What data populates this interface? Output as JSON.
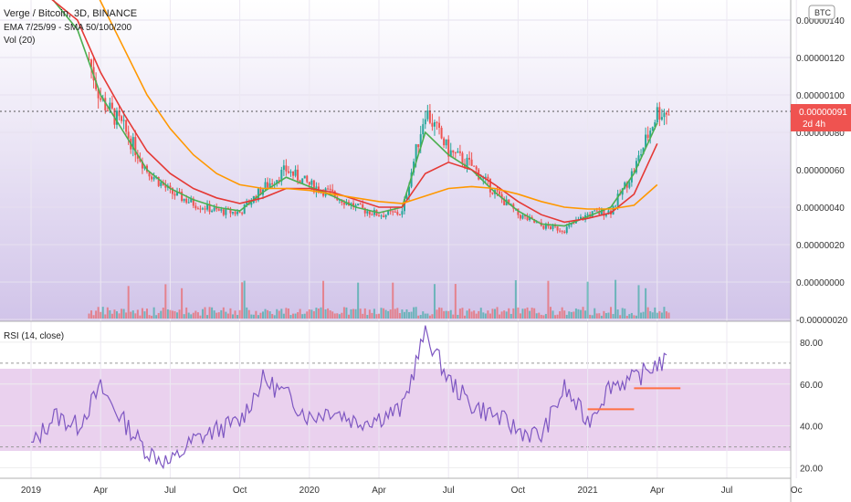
{
  "header": {
    "symbol_line": "Verge / Bitcoin, 3D, BINANCE",
    "ema_line": "EMA 7/25/99 - SMA 50/100/200",
    "vol_line": "Vol (20)",
    "currency_badge": "BTC"
  },
  "rsi_panel": {
    "title": "RSI (14, close)"
  },
  "last_price": {
    "value": "0.00000091",
    "countdown": "2d 4h"
  },
  "colors": {
    "up": "#26a69a",
    "down": "#ef5350",
    "ema7": "#4caf50",
    "ema25": "#e53935",
    "ema99": "#ff9800",
    "sma50": "#ff7043",
    "sma100": "#8e24aa",
    "sma200": "#5e35b1",
    "rsi_line": "#7e57c2",
    "rsi_band": "#e1bee7",
    "price_bg_top": "#ffffff",
    "price_bg_bottom": "#d1c4e9",
    "trend_line": "#ff7043"
  },
  "chart_data": [
    {
      "type": "line",
      "name": "price",
      "x_ticks": [
        "2019",
        "Apr",
        "Jul",
        "Oct",
        "2020",
        "Apr",
        "Jul",
        "Oct",
        "2021",
        "Apr",
        "Jul",
        "Oc"
      ],
      "y_ticks": [
        "0.00000140",
        "0.00000120",
        "0.00000100",
        "0.00000080",
        "0.00000060",
        "0.00000040",
        "0.00000020",
        "0.00000000",
        "-0.00000020"
      ],
      "ylim": [
        -2e-07,
        1.4e-06
      ],
      "x": [
        "2019-01",
        "2019-03",
        "2019-04",
        "2019-05",
        "2019-06",
        "2019-07",
        "2019-08",
        "2019-09",
        "2019-10",
        "2019-11",
        "2019-12",
        "2020-01",
        "2020-02",
        "2020-03",
        "2020-04",
        "2020-05",
        "2020-06",
        "2020-07",
        "2020-08",
        "2020-09",
        "2020-10",
        "2020-11",
        "2020-12",
        "2021-01",
        "2021-02",
        "2021-03",
        "2021-04"
      ],
      "close": [
        1.7e-06,
        1.4e-06,
        9.8e-07,
        8.2e-07,
        6e-07,
        4.8e-07,
        4.2e-07,
        3.8e-07,
        3.7e-07,
        5e-07,
        6e-07,
        5.2e-07,
        4.7e-07,
        4e-07,
        3.6e-07,
        3.7e-07,
        9.2e-07,
        7e-07,
        6.2e-07,
        4.8e-07,
        3.6e-07,
        3e-07,
        2.8e-07,
        3.6e-07,
        3.8e-07,
        6e-07,
        9.1e-07
      ],
      "series": [
        {
          "name": "EMA 7",
          "values": [
            1.65e-06,
            1.35e-06,
            1e-06,
            8e-07,
            6e-07,
            5e-07,
            4.4e-07,
            4e-07,
            3.8e-07,
            4.8e-07,
            5.6e-07,
            5.1e-07,
            4.6e-07,
            4e-07,
            3.7e-07,
            4e-07,
            8e-07,
            6.8e-07,
            6e-07,
            4.8e-07,
            3.8e-07,
            3.1e-07,
            3e-07,
            3.5e-07,
            4e-07,
            5.8e-07,
            8.5e-07
          ]
        },
        {
          "name": "EMA 25",
          "values": [
            1.6e-06,
            1.4e-06,
            1.12e-06,
            9e-07,
            7e-07,
            5.8e-07,
            5e-07,
            4.5e-07,
            4.2e-07,
            4.5e-07,
            5e-07,
            5e-07,
            4.8e-07,
            4.4e-07,
            4e-07,
            4e-07,
            5.8e-07,
            6.4e-07,
            6e-07,
            5.2e-07,
            4.3e-07,
            3.6e-07,
            3.2e-07,
            3.4e-07,
            3.7e-07,
            4.7e-07,
            7.4e-07
          ]
        },
        {
          "name": "EMA 99",
          "values": [
            2e-06,
            1.75e-06,
            1.5e-06,
            1.25e-06,
            1e-06,
            8.2e-07,
            6.8e-07,
            5.8e-07,
            5.2e-07,
            5e-07,
            5e-07,
            4.9e-07,
            4.7e-07,
            4.5e-07,
            4.3e-07,
            4.2e-07,
            4.6e-07,
            5e-07,
            5.1e-07,
            5e-07,
            4.7e-07,
            4.3e-07,
            4e-07,
            3.9e-07,
            3.9e-07,
            4.1e-07,
            5.2e-07
          ]
        }
      ],
      "volume": {
        "label": "Vol (20)"
      }
    },
    {
      "type": "line",
      "name": "RSI (14, close)",
      "y_ticks": [
        "80.00",
        "60.00",
        "40.00",
        "20.00"
      ],
      "ylim": [
        15,
        90
      ],
      "bands": {
        "upper": 70,
        "lower": 30
      },
      "x": [
        "2019-01",
        "2019-02",
        "2019-03",
        "2019-04",
        "2019-05",
        "2019-06",
        "2019-07",
        "2019-08",
        "2019-09",
        "2019-10",
        "2019-11",
        "2019-12",
        "2020-01",
        "2020-02",
        "2020-03",
        "2020-04",
        "2020-05",
        "2020-06",
        "2020-07",
        "2020-08",
        "2020-09",
        "2020-10",
        "2020-11",
        "2020-12",
        "2021-01",
        "2021-02",
        "2021-03",
        "2021-04"
      ],
      "values": [
        30,
        45,
        40,
        58,
        42,
        28,
        22,
        33,
        38,
        42,
        62,
        55,
        44,
        48,
        42,
        44,
        48,
        85,
        62,
        50,
        45,
        38,
        35,
        58,
        42,
        60,
        62,
        70
      ],
      "trend_lines": [
        {
          "from": [
            "2021-01",
            48
          ],
          "to": [
            "2021-03",
            48
          ]
        },
        {
          "from": [
            "2021-03",
            58
          ],
          "to": [
            "2021-05",
            58
          ]
        }
      ]
    }
  ]
}
